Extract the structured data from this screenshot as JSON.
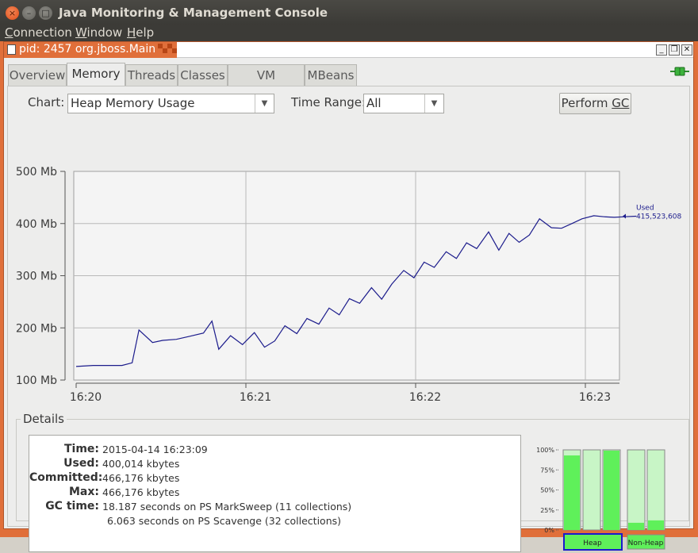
{
  "window": {
    "title": "Java Monitoring & Management Console",
    "close_glyph": "×",
    "min_glyph": "–",
    "max_glyph": "□"
  },
  "menu": {
    "items": [
      {
        "label": "Connection",
        "mnemonic": "C"
      },
      {
        "label": "Window",
        "mnemonic": "W"
      },
      {
        "label": "Help",
        "mnemonic": "H"
      }
    ]
  },
  "document": {
    "title": "pid: 2457 org.jboss.Main"
  },
  "tabs": [
    {
      "label": "Overview",
      "active": false
    },
    {
      "label": "Memory",
      "active": true
    },
    {
      "label": "Threads",
      "active": false
    },
    {
      "label": "Classes",
      "active": false
    },
    {
      "label": "VM Summary",
      "active": false
    },
    {
      "label": "MBeans",
      "active": false
    }
  ],
  "controls": {
    "chart_label": "Chart:",
    "chart_value": "Heap Memory Usage",
    "time_range_label": "Time Range:",
    "time_range_value": "All",
    "perform_gc": "Perform GC"
  },
  "chart_data": {
    "type": "line",
    "y_ticks": [
      "500 Mb",
      "400 Mb",
      "300 Mb",
      "200 Mb",
      "100 Mb"
    ],
    "x_ticks": [
      "16:20",
      "16:21",
      "16:22",
      "16:23"
    ],
    "ylim": [
      100,
      500
    ],
    "grid": true,
    "series": [
      {
        "name": "Used",
        "color": "#1c1c8c",
        "current_value": "415,523,608",
        "x": [
          0.0,
          0.1,
          0.2,
          0.27,
          0.33,
          0.37,
          0.45,
          0.51,
          0.59,
          0.67,
          0.75,
          0.8,
          0.84,
          0.91,
          0.98,
          1.05,
          1.11,
          1.17,
          1.23,
          1.3,
          1.36,
          1.43,
          1.49,
          1.55,
          1.61,
          1.67,
          1.74,
          1.8,
          1.86,
          1.93,
          1.99,
          2.05,
          2.11,
          2.18,
          2.24,
          2.3,
          2.36,
          2.43,
          2.49,
          2.55,
          2.61,
          2.67,
          2.73,
          2.8,
          2.86,
          2.92,
          2.98,
          3.05,
          3.11,
          3.17,
          3.23,
          3.3
        ],
        "y": [
          126,
          128,
          128,
          128,
          133,
          196,
          172,
          176,
          178,
          184,
          190,
          213,
          159,
          185,
          168,
          191,
          163,
          175,
          204,
          189,
          218,
          207,
          238,
          225,
          256,
          247,
          277,
          255,
          284,
          310,
          296,
          326,
          316,
          346,
          333,
          363,
          352,
          384,
          349,
          381,
          364,
          378,
          409,
          392,
          391,
          400,
          409,
          415,
          413,
          412,
          413,
          414
        ]
      }
    ]
  },
  "details": {
    "title": "Details",
    "rows": [
      {
        "key": "Time:",
        "value": "2015-04-14 16:23:09"
      },
      {
        "key": "Used:",
        "value": "400,014 kbytes"
      },
      {
        "key": "Committed:",
        "value": "466,176 kbytes"
      },
      {
        "key": "Max:",
        "value": "466,176 kbytes"
      },
      {
        "key": "GC time:",
        "value": "18.187  seconds on PS MarkSweep (11 collections)"
      },
      {
        "key": "",
        "value": "6.063  seconds on PS Scavenge (32 collections)"
      }
    ]
  },
  "pool_chart": {
    "y_ticks": [
      "100%",
      "75%",
      "50%",
      "25%",
      "0%"
    ],
    "heap_label": "Heap",
    "nonheap_label": "Non-Heap",
    "heap_pools": [
      0.96,
      0,
      1.0
    ],
    "nonheap_pools": [
      0.09,
      0.12
    ],
    "fill_color": "#5ff05a",
    "track_color": "#c8f5c6"
  }
}
